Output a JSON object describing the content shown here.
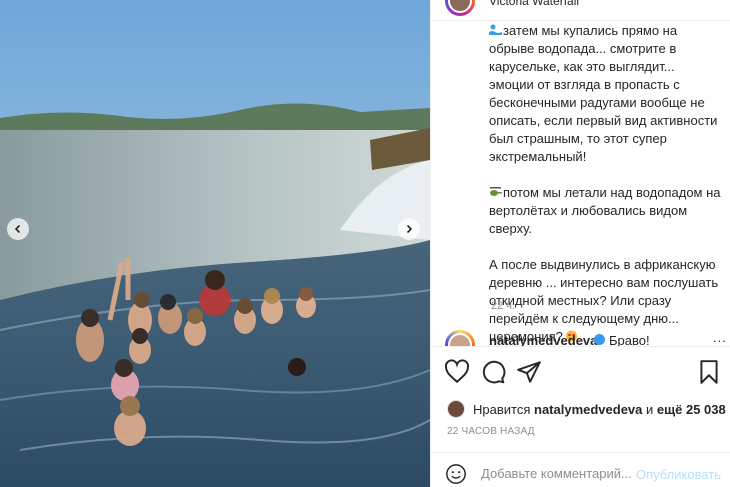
{
  "post": {
    "location": "Victoria Waterfall",
    "caption_paragraphs": [
      "затем мы купались прямо на обрыве водопада... смотрите в карусельке, как это выглядит... эмоции от взгляда в пропасть с бесконечными радугами вообще не описать, если первый вид активности был страшным, то этот супер экстремальный!",
      "потом мы летали над водопадом на вертолётах и любовались видом сверху.",
      "А после выдвинулись в африканскую деревню ... интересно вам послушать откидной местных? Или сразу перейдём к следующему дню... церемония?"
    ],
    "time_ago": "22 ч.",
    "top_comment": {
      "username": "natalymedvedeva",
      "text": "Браво!"
    },
    "more": "...",
    "likes": {
      "prefix": "Нравится",
      "user": "natalymedvedeva",
      "middle": "и",
      "others": "ещё 25 038"
    },
    "date": "22 ЧАСОВ НАЗАД",
    "comment_placeholder": "Добавьте комментарий...",
    "publish_label": "Опубликовать"
  },
  "icons": {
    "prev": "chevron-left-icon",
    "next": "chevron-right-icon",
    "like": "heart-icon",
    "comment": "comment-icon",
    "share": "paper-plane-icon",
    "save": "bookmark-icon",
    "emoji": "smiley-icon"
  },
  "colors": {
    "accent": "#0095f6",
    "publish_disabled": "#b2dffc",
    "muted": "#8e8e8e",
    "text": "#262626"
  }
}
